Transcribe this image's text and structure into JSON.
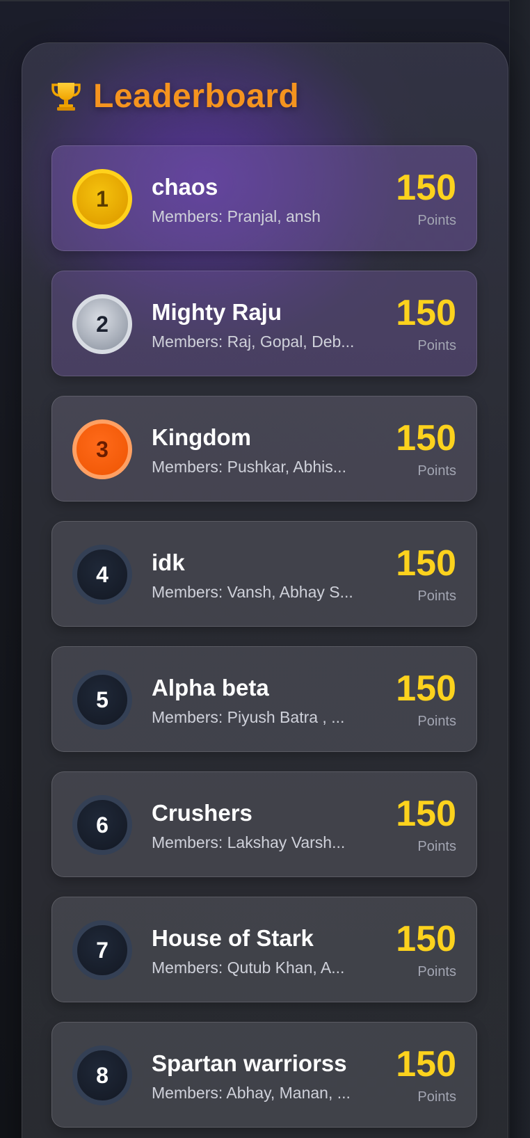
{
  "header": {
    "title": "Leaderboard",
    "icon": "trophy-icon",
    "accent": "#f5941f"
  },
  "colors": {
    "score": "#fcd21d",
    "gold": "#ffd21c",
    "silver": "#d8dce3",
    "bronze": "#ff6a1a"
  },
  "leaderboard": [
    {
      "rank": "1",
      "team": "chaos",
      "members": "Members: Pranjal, ansh",
      "score": "150",
      "score_label": "Points"
    },
    {
      "rank": "2",
      "team": "Mighty Raju",
      "members": "Members: Raj, Gopal, Deb...",
      "score": "150",
      "score_label": "Points"
    },
    {
      "rank": "3",
      "team": "Kingdom",
      "members": "Members: Pushkar, Abhis...",
      "score": "150",
      "score_label": "Points"
    },
    {
      "rank": "4",
      "team": "idk",
      "members": "Members: Vansh, Abhay S...",
      "score": "150",
      "score_label": "Points"
    },
    {
      "rank": "5",
      "team": "Alpha beta",
      "members": "Members: Piyush Batra , ...",
      "score": "150",
      "score_label": "Points"
    },
    {
      "rank": "6",
      "team": "Crushers",
      "members": "Members: Lakshay Varsh...",
      "score": "150",
      "score_label": "Points"
    },
    {
      "rank": "7",
      "team": "House of Stark",
      "members": "Members: Qutub Khan, A...",
      "score": "150",
      "score_label": "Points"
    },
    {
      "rank": "8",
      "team": "Spartan warriorss",
      "members": "Members: Abhay, Manan, ...",
      "score": "150",
      "score_label": "Points"
    }
  ]
}
